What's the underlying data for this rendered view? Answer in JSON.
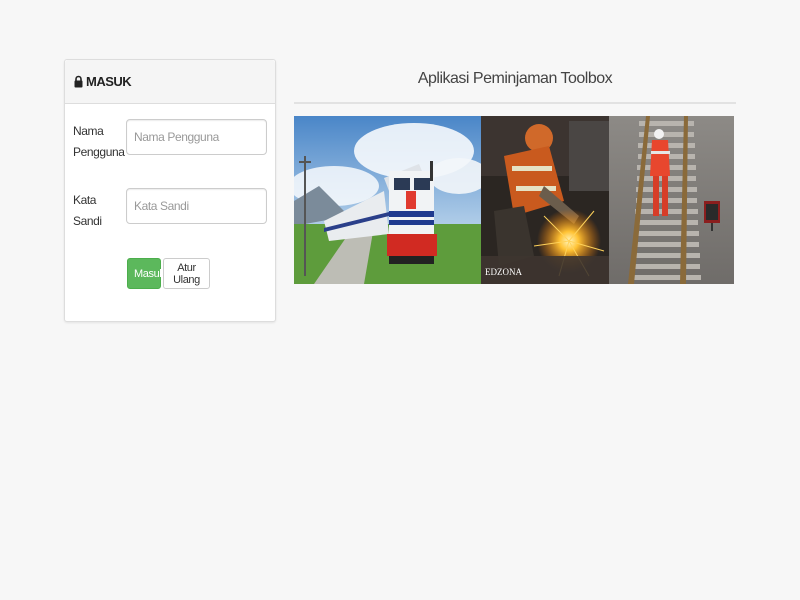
{
  "login_panel": {
    "title": "MASUK",
    "lock_icon": "lock-icon",
    "username": {
      "label": "Nama Pengguna",
      "placeholder": "Nama Pengguna",
      "value": ""
    },
    "password": {
      "label": "Kata Sandi",
      "placeholder": "Kata Sandi",
      "value": ""
    },
    "login_button": "Masuk",
    "reset_button": "Atur Ulang"
  },
  "main": {
    "app_title": "Aplikasi Peminjaman Toolbox",
    "banner": {
      "photos": [
        "train-photo",
        "welding-worker-photo",
        "railway-track-worker-photo"
      ],
      "watermark": "EDZONA"
    }
  },
  "colors": {
    "background": "#f7f7f7",
    "login_button": "#5cb85c",
    "panel_border": "#dddddd"
  }
}
